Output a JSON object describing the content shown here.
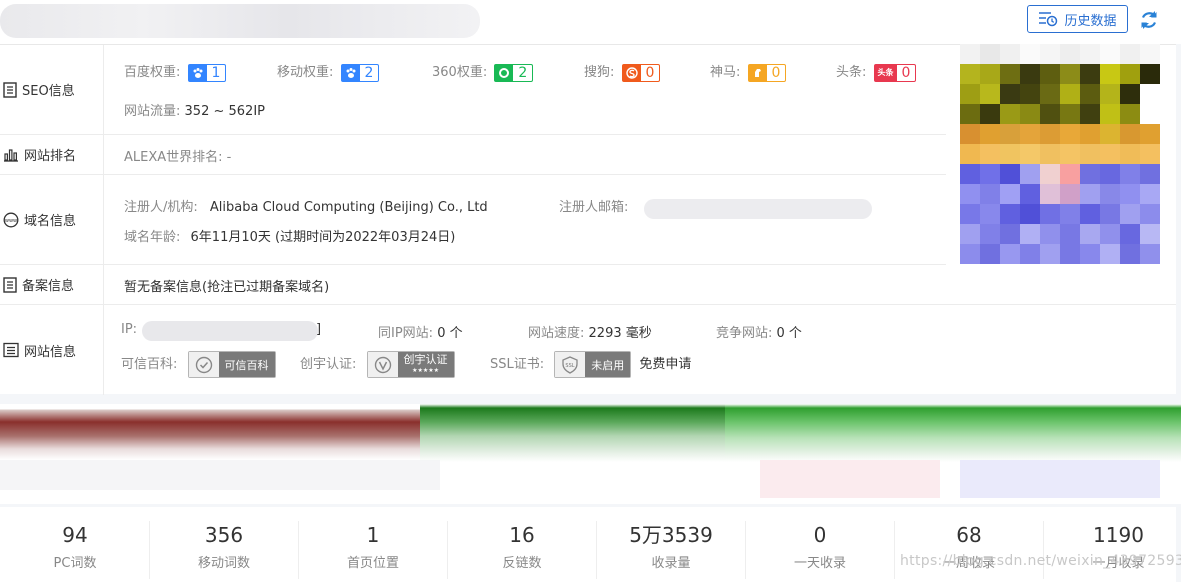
{
  "header": {
    "history_label": "历史数据"
  },
  "seo": {
    "label": "SEO信息",
    "baidu_label": "百度权重:",
    "baidu_value": "1",
    "mobile_label": "移动权重:",
    "mobile_value": "2",
    "s360_label": "360权重:",
    "s360_value": "2",
    "sogou_label": "搜狗:",
    "sogou_value": "0",
    "shenma_label": "神马:",
    "shenma_value": "0",
    "toutiao_label": "头条:",
    "toutiao_value": "0",
    "toutiao_icon_text": "头条",
    "traffic_label": "网站流量:",
    "traffic_value": "352 ~ 562IP"
  },
  "ranking": {
    "label": "网站排名",
    "alexa_label": "ALEXA世界排名:",
    "alexa_value": "-"
  },
  "domain": {
    "label": "域名信息",
    "registrant_label": "注册人/机构:",
    "registrant_value": "Alibaba Cloud Computing (Beijing) Co., Ltd",
    "email_label": "注册人邮箱:",
    "age_label": "域名年龄:",
    "age_value": "6年11月10天 (过期时间为2022年03月24日)"
  },
  "beian": {
    "label": "备案信息",
    "value": "暂无备案信息(抢注已过期备案域名)"
  },
  "site": {
    "label": "网站信息",
    "ip_label": "IP:",
    "ip_tail": "]",
    "same_ip_label": "同IP网站:",
    "same_ip_value": "0 个",
    "speed_label": "网站速度:",
    "speed_value": "2293 毫秒",
    "compete_label": "竞争网站:",
    "compete_value": "0 个",
    "kexin_label": "可信百科:",
    "kexin_badge": "可信百科",
    "chuangyu_label": "创宇认证:",
    "chuangyu_badge": "创宇认证",
    "chuangyu_stars": "★★★★★",
    "ssl_label": "SSL证书:",
    "ssl_badge": "未启用",
    "ssl_icon_text": "SSL",
    "ssl_apply": "免费申请"
  },
  "stats": [
    {
      "value": "94",
      "label": "PC词数"
    },
    {
      "value": "356",
      "label": "移动词数"
    },
    {
      "value": "1",
      "label": "首页位置"
    },
    {
      "value": "16",
      "label": "反链数"
    },
    {
      "value": "5万3539",
      "label": "收录量"
    },
    {
      "value": "0",
      "label": "一天收录"
    },
    {
      "value": "68",
      "label": "一周收录"
    },
    {
      "value": "1190",
      "label": "一月收录"
    }
  ],
  "watermark": "https://blog.csdn.net/weixin_43972593",
  "colors": {
    "accent": "#2a6fd1",
    "baidu": "#3385ff",
    "s360": "#19b955",
    "sogou": "#f05a1c",
    "shenma": "#f5a623",
    "toutiao": "#e8384f"
  }
}
